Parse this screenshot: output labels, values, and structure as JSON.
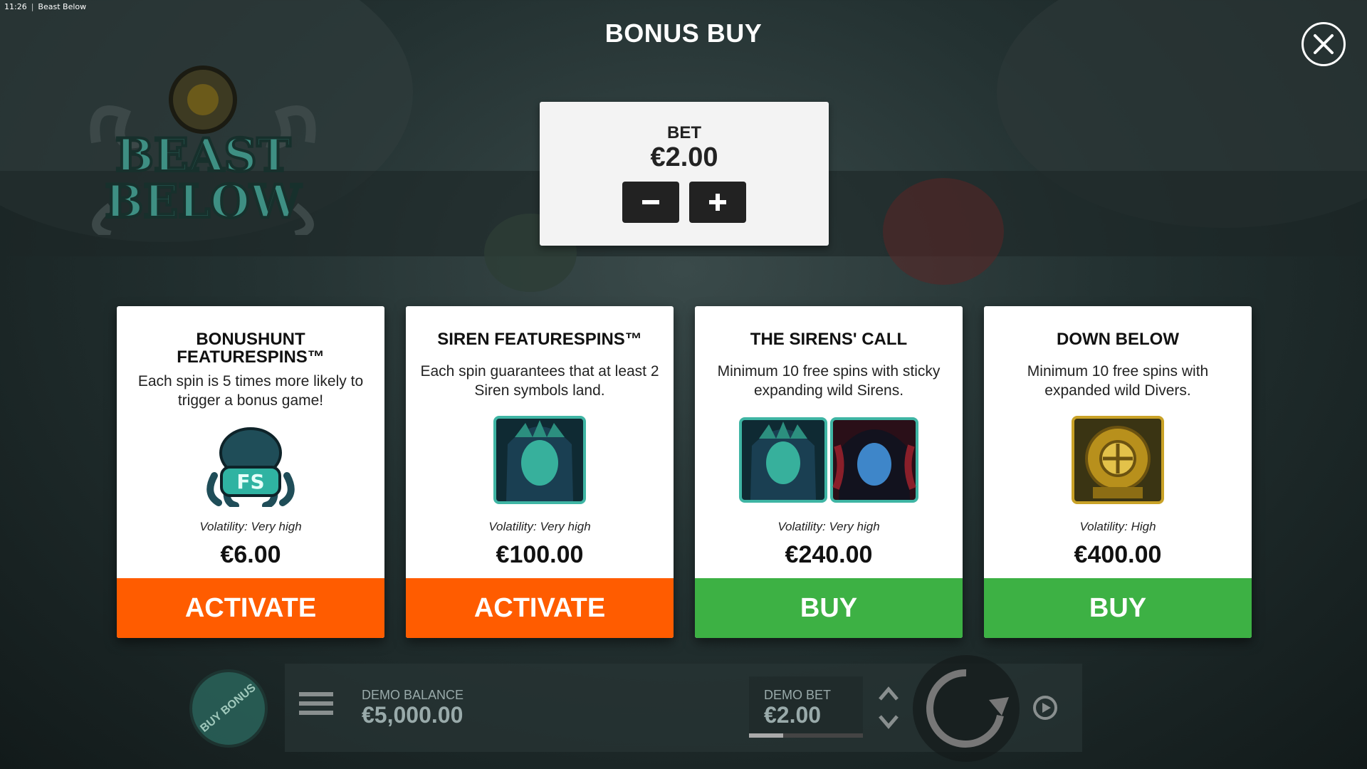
{
  "window": {
    "time": "11:26",
    "title": "Beast Below"
  },
  "modal": {
    "title": "BONUS BUY"
  },
  "icons": {
    "close": "close-icon",
    "minus": "minus-icon",
    "plus": "plus-icon",
    "menu": "menu-icon",
    "spin": "spin-icon",
    "autoplay": "autoplay-icon",
    "logo": "beast-below-logo"
  },
  "colors": {
    "activate": "#ff5c00",
    "buy": "#3db144",
    "panel": "#f3f3f3"
  },
  "bet": {
    "label": "BET",
    "value": "€2.00"
  },
  "cards": [
    {
      "title": "BONUSHUNT FEATURESPINS™",
      "description": "Each spin is 5 times more likely to trigger a bonus game!",
      "symbol": "FS",
      "volatility": "Volatility: Very high",
      "price": "€6.00",
      "action": "ACTIVATE"
    },
    {
      "title": "SIREN FEATURESPINS™",
      "description": "Each spin guarantees that at least 2 Siren symbols land.",
      "symbol": "",
      "volatility": "Volatility: Very high",
      "price": "€100.00",
      "action": "ACTIVATE"
    },
    {
      "title": "THE SIRENS' CALL",
      "description": "Minimum 10 free spins with sticky expanding wild Sirens.",
      "symbol": "",
      "volatility": "Volatility: Very high",
      "price": "€240.00",
      "action": "BUY"
    },
    {
      "title": "DOWN BELOW",
      "description": "Minimum 10 free spins with expanded wild Divers.",
      "symbol": "",
      "volatility": "Volatility: High",
      "price": "€400.00",
      "action": "BUY"
    }
  ],
  "bottom": {
    "buy_bonus": "BUY BONUS",
    "balance_label": "DEMO BALANCE",
    "balance_value": "€5,000.00",
    "bet_label": "DEMO BET",
    "bet_value": "€2.00",
    "bet_level_fraction": 0.3
  }
}
